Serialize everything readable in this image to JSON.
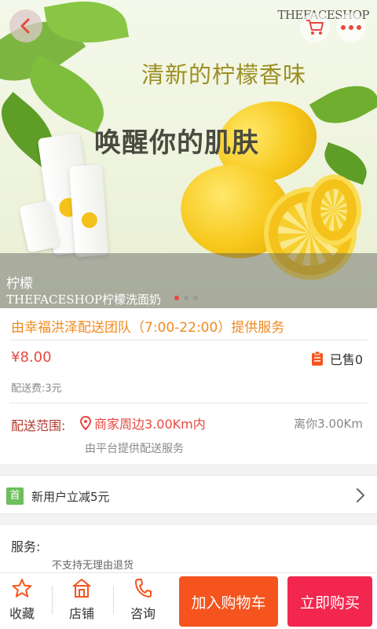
{
  "banner": {
    "slogan_line1": "清新的柠檬香味",
    "slogan_line2": "唤醒你的肌肤",
    "brand": "THEFACESHOP",
    "caption_title": "柠檬",
    "caption_subtitle": "THEFACESHOP柠檬洗面奶",
    "carousel_total": 3,
    "carousel_active": 1
  },
  "product": {
    "service_line": "由幸福洪泽配送团队（7:00-22:00）提供服务",
    "price": "¥8.00",
    "sold": "已售0",
    "delivery_fee": "配送费:3元",
    "range_label": "配送范围:",
    "range_value": "商家周边3.00Km内",
    "distance": "离你3.00Km",
    "platform_note": "由平台提供配送服务"
  },
  "promo": {
    "badge": "首",
    "text": "新用户立减5元"
  },
  "services": {
    "title": "服务:",
    "item": "不支持无理由退货"
  },
  "bottom_bar": {
    "favorite": "收藏",
    "shop": "店铺",
    "consult": "咨询",
    "add_to_cart": "加入购物车",
    "buy_now": "立即购买"
  },
  "colors": {
    "accent_orange": "#f08a1e",
    "price_red": "#e8483f",
    "cart_button": "#f5541f",
    "buy_button": "#f2264f",
    "promo_badge": "#6cbf5b"
  },
  "icons": [
    "back-arrow-icon",
    "cart-icon",
    "more-icon",
    "document-icon",
    "location-pin-icon",
    "chevron-right-icon",
    "star-icon",
    "shop-icon",
    "phone-icon"
  ]
}
